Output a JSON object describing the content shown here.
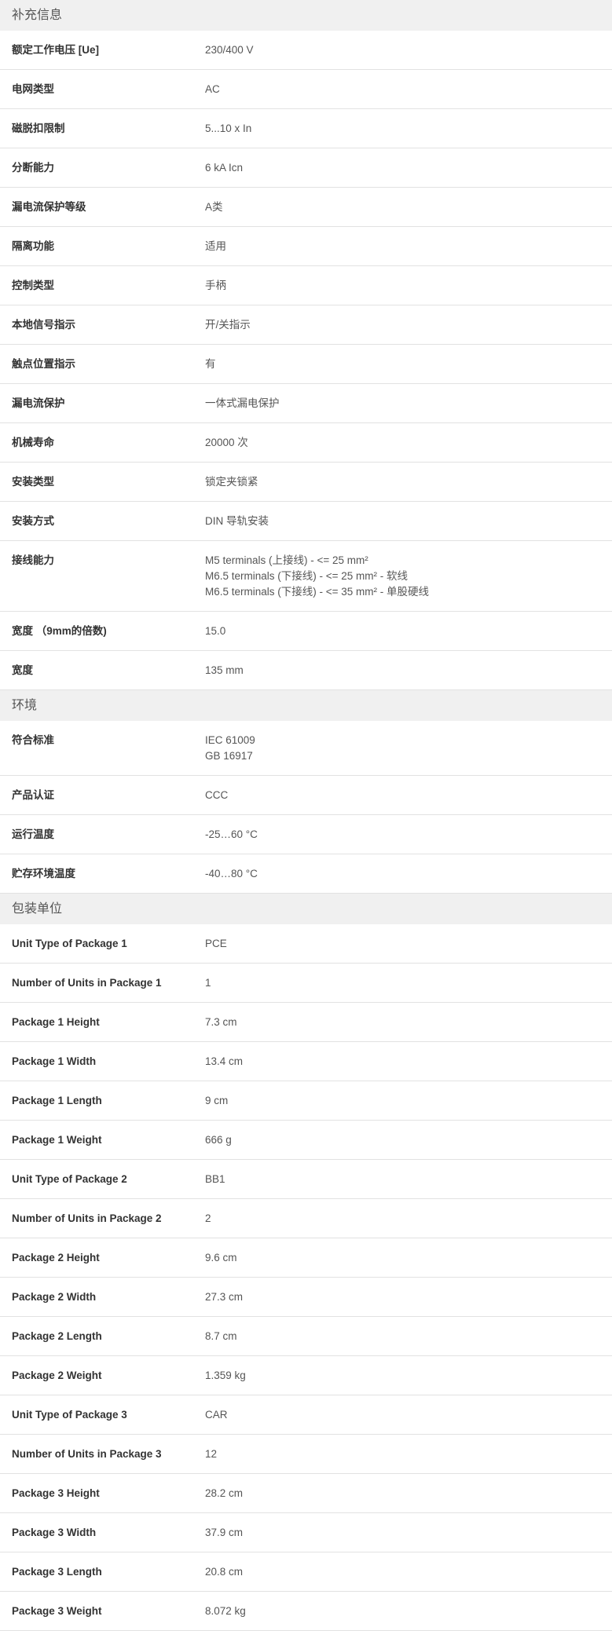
{
  "sections": [
    {
      "title": "补充信息",
      "rows": [
        {
          "label": "额定工作电压 [Ue]",
          "values": [
            "230/400 V"
          ]
        },
        {
          "label": "电网类型",
          "values": [
            "AC"
          ]
        },
        {
          "label": "磁脱扣限制",
          "values": [
            "5...10 x In"
          ]
        },
        {
          "label": "分断能力",
          "values": [
            "6 kA Icn"
          ]
        },
        {
          "label": "漏电流保护等级",
          "values": [
            "A类"
          ]
        },
        {
          "label": "隔离功能",
          "values": [
            "适用"
          ]
        },
        {
          "label": "控制类型",
          "values": [
            "手柄"
          ]
        },
        {
          "label": "本地信号指示",
          "values": [
            "开/关指示"
          ]
        },
        {
          "label": "触点位置指示",
          "values": [
            "有"
          ]
        },
        {
          "label": "漏电流保护",
          "values": [
            "一体式漏电保护"
          ]
        },
        {
          "label": "机械寿命",
          "values": [
            "20000 次"
          ]
        },
        {
          "label": "安装类型",
          "values": [
            "锁定夹锁紧"
          ]
        },
        {
          "label": "安装方式",
          "values": [
            "DIN 导轨安装"
          ]
        },
        {
          "label": "接线能力",
          "values": [
            "M5 terminals (上接线) - <= 25 mm²",
            "M6.5 terminals (下接线) - <= 25 mm² - 软线",
            "M6.5 terminals (下接线) - <= 35 mm² - 单股硬线"
          ]
        },
        {
          "label": "宽度 （9mm的倍数)",
          "values": [
            "15.0"
          ]
        },
        {
          "label": "宽度",
          "values": [
            "135 mm"
          ]
        }
      ]
    },
    {
      "title": "环境",
      "rows": [
        {
          "label": "符合标准",
          "values": [
            "IEC 61009",
            "GB 16917"
          ]
        },
        {
          "label": "产品认证",
          "values": [
            "CCC"
          ]
        },
        {
          "label": "运行温度",
          "values": [
            "-25…60 °C"
          ]
        },
        {
          "label": "贮存环境温度",
          "values": [
            "-40…80 °C"
          ]
        }
      ]
    },
    {
      "title": "包装单位",
      "rows": [
        {
          "label": "Unit Type of Package 1",
          "values": [
            "PCE"
          ]
        },
        {
          "label": "Number of Units in Package 1",
          "values": [
            "1"
          ]
        },
        {
          "label": "Package 1 Height",
          "values": [
            "7.3 cm"
          ]
        },
        {
          "label": "Package 1 Width",
          "values": [
            "13.4 cm"
          ]
        },
        {
          "label": "Package 1 Length",
          "values": [
            "9 cm"
          ]
        },
        {
          "label": "Package 1 Weight",
          "values": [
            "666 g"
          ]
        },
        {
          "label": "Unit Type of Package 2",
          "values": [
            "BB1"
          ]
        },
        {
          "label": "Number of Units in Package 2",
          "values": [
            "2"
          ]
        },
        {
          "label": "Package 2 Height",
          "values": [
            "9.6 cm"
          ]
        },
        {
          "label": "Package 2 Width",
          "values": [
            "27.3 cm"
          ]
        },
        {
          "label": "Package 2 Length",
          "values": [
            "8.7 cm"
          ]
        },
        {
          "label": "Package 2 Weight",
          "values": [
            "1.359 kg"
          ]
        },
        {
          "label": "Unit Type of Package 3",
          "values": [
            "CAR"
          ]
        },
        {
          "label": "Number of Units in Package 3",
          "values": [
            "12"
          ]
        },
        {
          "label": "Package 3 Height",
          "values": [
            "28.2 cm"
          ]
        },
        {
          "label": "Package 3 Width",
          "values": [
            "37.9 cm"
          ]
        },
        {
          "label": "Package 3 Length",
          "values": [
            "20.8 cm"
          ]
        },
        {
          "label": "Package 3 Weight",
          "values": [
            "8.072 kg"
          ]
        }
      ]
    }
  ]
}
